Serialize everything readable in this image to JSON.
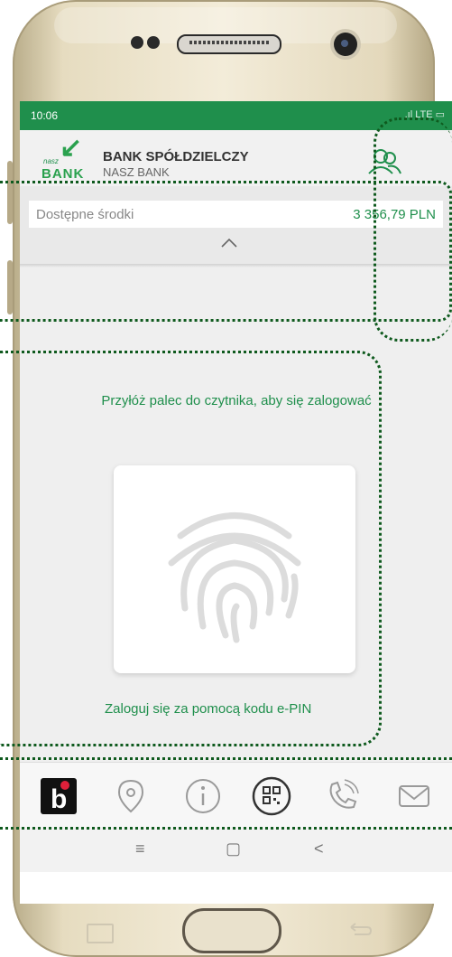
{
  "status_bar": {
    "time": "10:06",
    "icons": ".ıl LTE ▭"
  },
  "header": {
    "logo_small": "nasz",
    "logo_word": "BANK",
    "bank_name": "BANK SPÓŁDZIELCZY",
    "bank_sub": "NASZ BANK"
  },
  "balance": {
    "label": "Dostępne środki",
    "value": "3 356,79 PLN"
  },
  "login": {
    "prompt": "Przyłóż palec do czytnika, aby się zalogować",
    "epin_link": "Zaloguj się za pomocą kodu e-PIN"
  },
  "bottom_nav": {
    "items": [
      "blik-icon",
      "location-icon",
      "info-icon",
      "qr-code-icon",
      "phone-icon",
      "mail-icon"
    ]
  },
  "android_nav": {
    "recent": "≡",
    "home": "▢",
    "back": "<"
  },
  "colors": {
    "accent": "#1f8f4c",
    "highlight": "#0f5a1e"
  }
}
